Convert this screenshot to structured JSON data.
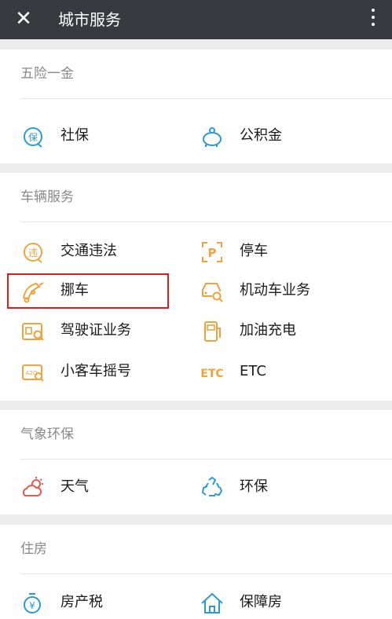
{
  "header": {
    "title": "城市服务"
  },
  "sections": [
    {
      "title": "五险一金",
      "items": [
        {
          "label": "社保",
          "icon": "shield-badge-icon"
        },
        {
          "label": "公积金",
          "icon": "piggy-bank-icon"
        }
      ]
    },
    {
      "title": "车辆服务",
      "items": [
        {
          "label": "交通违法",
          "icon": "violation-badge-icon"
        },
        {
          "label": "停车",
          "icon": "parking-icon"
        },
        {
          "label": "挪车",
          "icon": "move-car-icon"
        },
        {
          "label": "机动车业务",
          "icon": "car-search-icon"
        },
        {
          "label": "驾驶证业务",
          "icon": "license-icon"
        },
        {
          "label": "加油充电",
          "icon": "fuel-icon"
        },
        {
          "label": "小客车摇号",
          "icon": "plate-lottery-icon"
        },
        {
          "label": "ETC",
          "icon": "etc-icon"
        }
      ]
    },
    {
      "title": "气象环保",
      "items": [
        {
          "label": "天气",
          "icon": "weather-icon"
        },
        {
          "label": "环保",
          "icon": "recycle-icon"
        }
      ]
    },
    {
      "title": "住房",
      "items": [
        {
          "label": "房产税",
          "icon": "tax-icon"
        },
        {
          "label": "保障房",
          "icon": "house-icon"
        }
      ]
    }
  ],
  "icon_text": {
    "bao": "保",
    "wei": "违",
    "p": "P",
    "etc": "ETC",
    "azq": "A2Q",
    "yen": "¥"
  },
  "colors": {
    "topbar": "#393a3f",
    "icon_orange": "#f0a23c",
    "icon_blue": "#2a9bd6",
    "icon_red": "#e75a4e",
    "highlight": "#e51c1c"
  }
}
